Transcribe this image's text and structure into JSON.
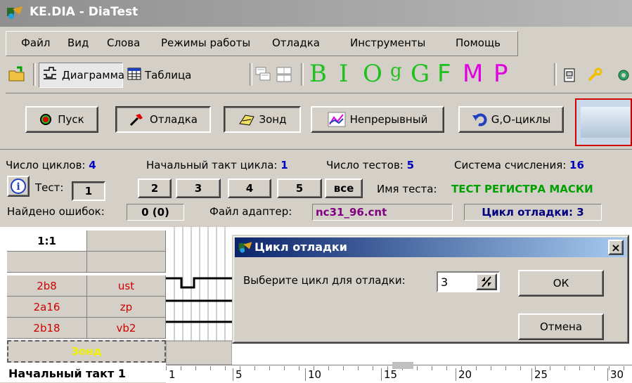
{
  "window": {
    "title": "KE.DIA - DiaTest"
  },
  "menu": [
    "Файл",
    "Вид",
    "Слова",
    "Режимы работы",
    "Отладка",
    "Инструменты",
    "Помощь"
  ],
  "toolbar": {
    "diagram": "Диаграмма",
    "table": "Таблица",
    "letters": [
      {
        "ch": "B",
        "color": "#20c020"
      },
      {
        "ch": "I",
        "color": "#20c020"
      },
      {
        "ch": "O",
        "color": "#20c020"
      },
      {
        "ch": "g",
        "color": "#20c020"
      },
      {
        "ch": "G",
        "color": "#20c020"
      },
      {
        "ch": "F",
        "color": "#20c020"
      },
      {
        "ch": "M",
        "color": "#e000e0"
      },
      {
        "ch": "P",
        "color": "#e000e0"
      }
    ]
  },
  "controls": {
    "start": "Пуск",
    "debug": "Отладка",
    "probe": "Зонд",
    "continuous": "Непрерывный",
    "cycles": "G,O-циклы"
  },
  "info": {
    "cycles_label": "Число циклов:",
    "cycles_value": "4",
    "start_tick_label": "Начальный такт цикла:",
    "start_tick_value": "1",
    "tests_label": "Число тестов:",
    "tests_value": "5",
    "radix_label": "Система счисления:",
    "radix_value": "16",
    "test_label": "Тест:",
    "test_buttons": [
      "1",
      "2",
      "3",
      "4",
      "5",
      "все"
    ],
    "test_name_label": "Имя теста:",
    "test_name_value": "ТЕСТ РЕГИСТРА МАСКИ",
    "errors_label": "Найдено ошибок:",
    "errors_value": "0 (0)",
    "adapter_label": "Файл адаптер:",
    "adapter_value": "nc31_96.cnt",
    "debug_cycle": "Цикл отладки: 3"
  },
  "grid": {
    "scale": "1:1",
    "rows": [
      {
        "a": "2b8",
        "b": "ust"
      },
      {
        "a": "2a16",
        "b": "zp"
      },
      {
        "a": "2b18",
        "b": "vb2"
      }
    ],
    "probe": "Зонд",
    "start_tick": "Начальный такт 1",
    "ticks": [
      "1",
      "5",
      "10",
      "15",
      "20",
      "25",
      "30"
    ]
  },
  "dialog": {
    "title": "Цикл отладки",
    "close": "×",
    "prompt": "Выберите цикл для отладки:",
    "value": "3",
    "ok": "ОК",
    "cancel": "Отмена"
  }
}
